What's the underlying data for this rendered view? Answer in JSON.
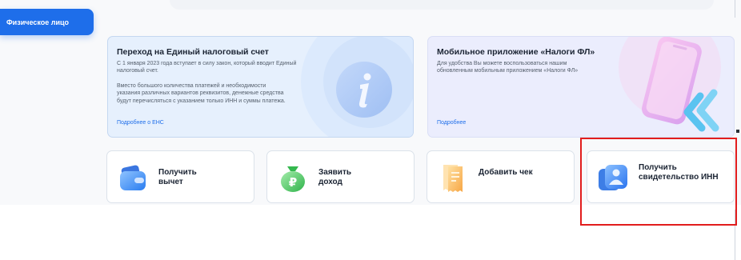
{
  "sidebar": {
    "active_item": "Физическое лицо"
  },
  "promo_ens": {
    "title": "Переход на Единый налоговый счет",
    "text1": "С 1 января 2023 года вступает в силу закон, который вводит Единый налоговый счет.",
    "text2": "Вместо большого количества платежей и необходимости указания различных вариантов реквизитов, денежные средства будут перечисляться с указанием только ИНН и суммы платежа.",
    "link": "Подробнее о ЕНС"
  },
  "promo_app": {
    "title": "Мобильное приложение «Налоги ФЛ»",
    "text": "Для удобства Вы можете воспользоваться нашим обновленным мобильным приложением «Налоги ФЛ»",
    "link": "Подробнее"
  },
  "actions": [
    {
      "label": "Получить вычет",
      "icon": "wallet-icon"
    },
    {
      "label": "Заявить доход",
      "icon": "ruble-bag-icon"
    },
    {
      "label": "Добавить чек",
      "icon": "receipt-icon"
    },
    {
      "label": "Получить свидетельство ИНН",
      "icon": "id-card-icon"
    }
  ],
  "colors": {
    "accent": "#1e6eea",
    "highlight": "#e21d1d"
  }
}
